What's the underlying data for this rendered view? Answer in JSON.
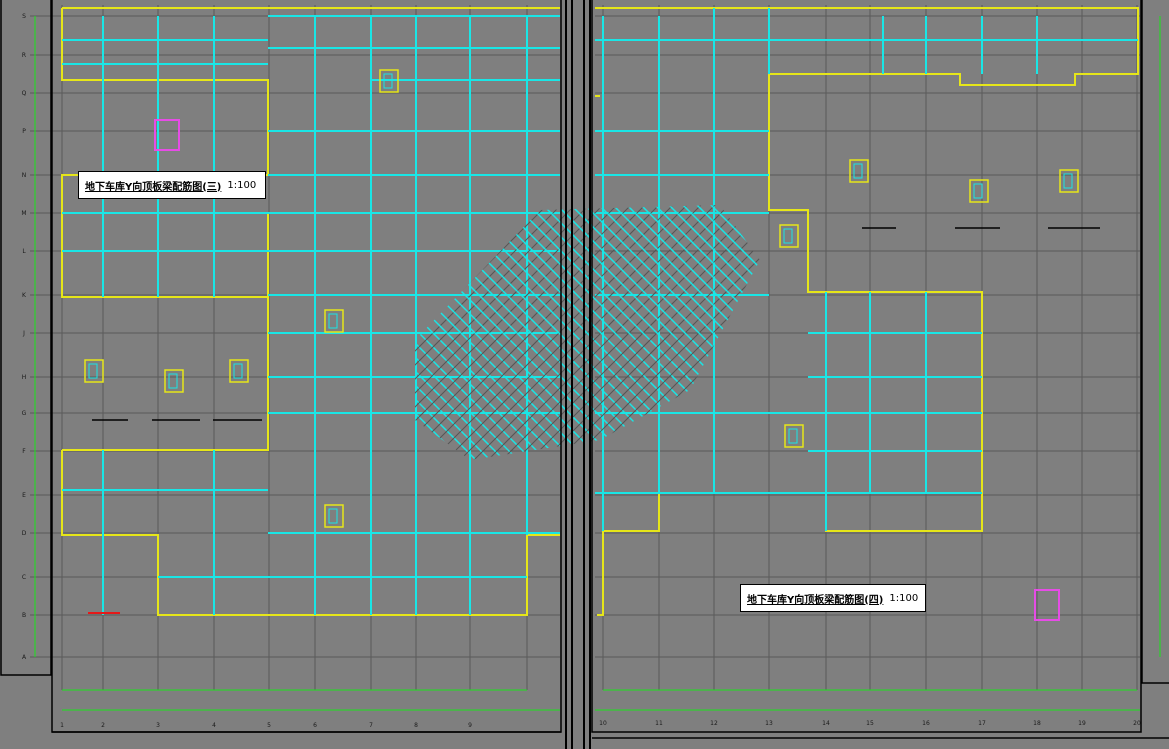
{
  "titles": {
    "left": {
      "main": "地下车库Y向顶板梁配筋图(三)",
      "scale": "1:100"
    },
    "right": {
      "main": "地下车库Y向顶板梁配筋图(四)",
      "scale": "1:100"
    }
  },
  "axes": {
    "left_bottom": [
      "1",
      "2",
      "3",
      "4",
      "5",
      "6",
      "7",
      "8",
      "9"
    ],
    "right_bottom": [
      "10",
      "11",
      "12",
      "13",
      "14",
      "15",
      "16",
      "17",
      "18",
      "19",
      "20"
    ],
    "left_side": [
      "S",
      "R",
      "Q",
      "P",
      "N",
      "M",
      "L",
      "K",
      "J",
      "H",
      "G",
      "F",
      "E",
      "D",
      "C",
      "B",
      "A"
    ]
  },
  "colors": {
    "background": "#7f7f7f",
    "beam": "#19e6e6",
    "slab_outline": "#e6e619",
    "axis_dim": "#19e619",
    "grid": "#5a5a5a",
    "legend": "#e64ce6",
    "frame": "#000000"
  }
}
